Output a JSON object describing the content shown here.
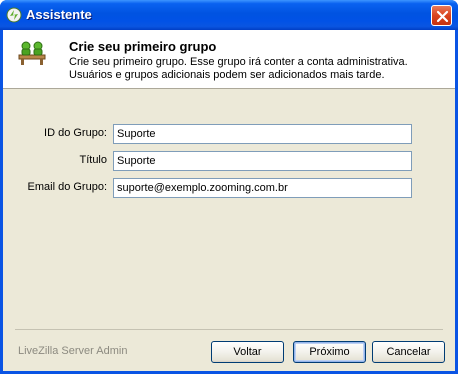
{
  "window": {
    "title": "Assistente"
  },
  "header": {
    "title": "Crie seu primeiro grupo",
    "description": "Crie seu primeiro grupo. Esse grupo irá conter a conta administrativa. Usuários e grupos adicionais podem ser adicionados mais tarde.",
    "icon": "group-users-icon"
  },
  "form": {
    "fields": [
      {
        "label": "ID do Grupo:",
        "value": "Suporte"
      },
      {
        "label": "Título",
        "value": "Suporte"
      },
      {
        "label": "Email do Grupo:",
        "value": "suporte@exemplo.zooming.com.br"
      }
    ]
  },
  "footer": {
    "brand": "LiveZilla Server Admin",
    "back_label": "Voltar",
    "next_label": "Próximo",
    "cancel_label": "Cancelar"
  },
  "colors": {
    "titlebar": "#0053e1",
    "dialog_bg": "#ece9d8",
    "close_button": "#d9431d"
  }
}
